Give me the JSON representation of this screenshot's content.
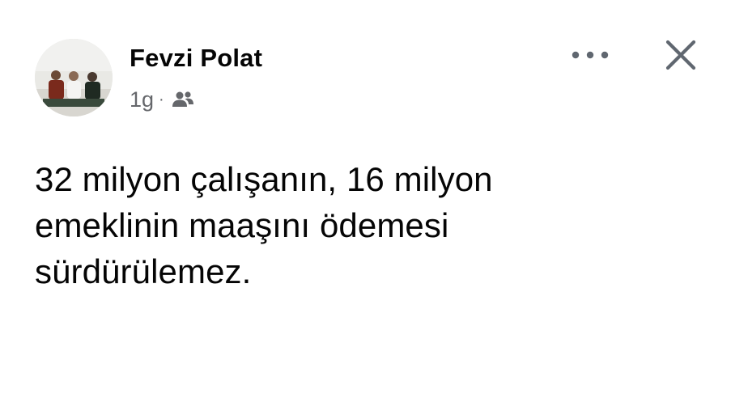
{
  "post": {
    "author_name": "Fevzi Polat",
    "timestamp": "1g",
    "separator": "·",
    "audience_icon": "friends-icon",
    "more_icon": "more-options-icon",
    "close_icon": "close-icon",
    "text": "32 milyon çalışanın, 16 milyon\nemeklinin maaşını ödemesi\nsürdürülemez."
  },
  "colors": {
    "text_primary": "#050505",
    "text_secondary": "#65676b",
    "background": "#ffffff"
  }
}
